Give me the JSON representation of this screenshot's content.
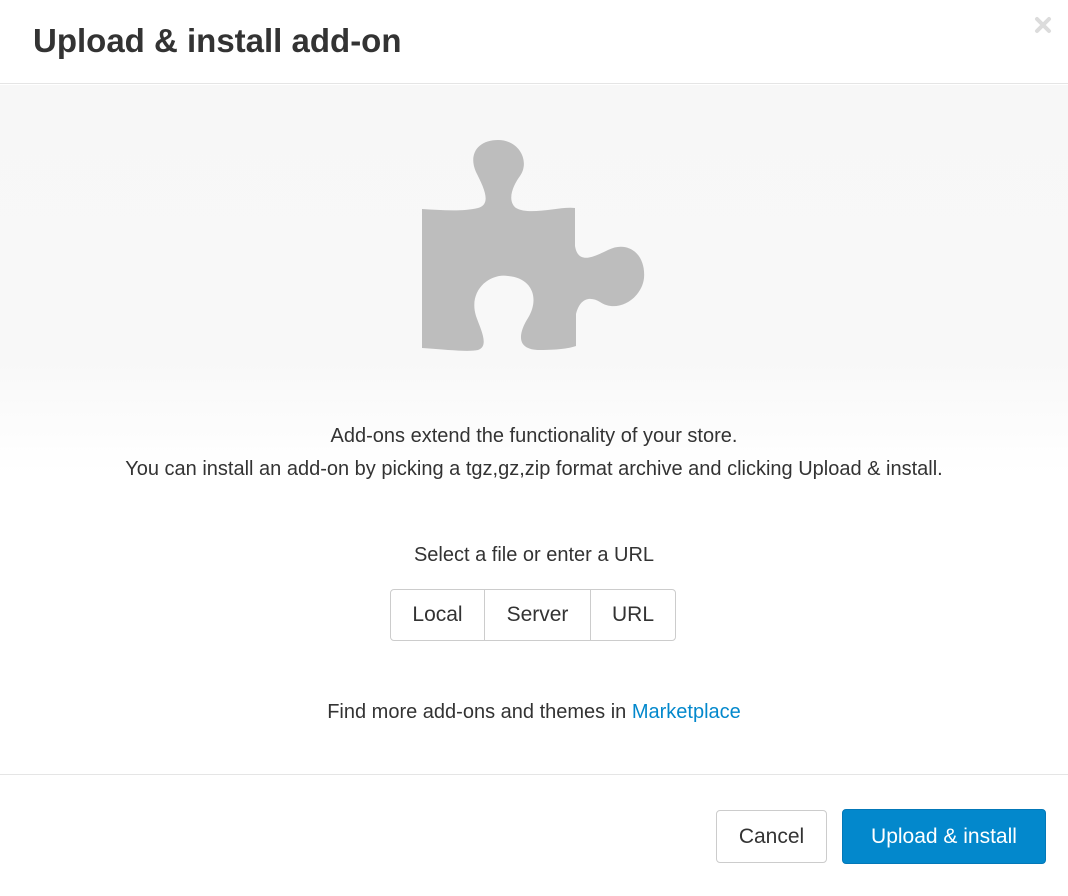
{
  "dialog": {
    "title": "Upload & install add-on",
    "close_icon": "close-icon"
  },
  "hero": {
    "icon": "puzzle-piece-icon",
    "icon_color": "#bdbdbd",
    "description_line1": "Add-ons extend the functionality of your store.",
    "description_line2": "You can install an add-on by picking a tgz,gz,zip format archive and clicking Upload & install."
  },
  "source": {
    "label": "Select a file or enter a URL",
    "options": [
      "Local",
      "Server",
      "URL"
    ]
  },
  "marketplace": {
    "prefix": "Find more add-ons and themes in",
    "link_label": "Marketplace",
    "link_color": "#0388cc"
  },
  "footer": {
    "cancel_label": "Cancel",
    "submit_label": "Upload & install",
    "primary_color": "#0388cc"
  }
}
